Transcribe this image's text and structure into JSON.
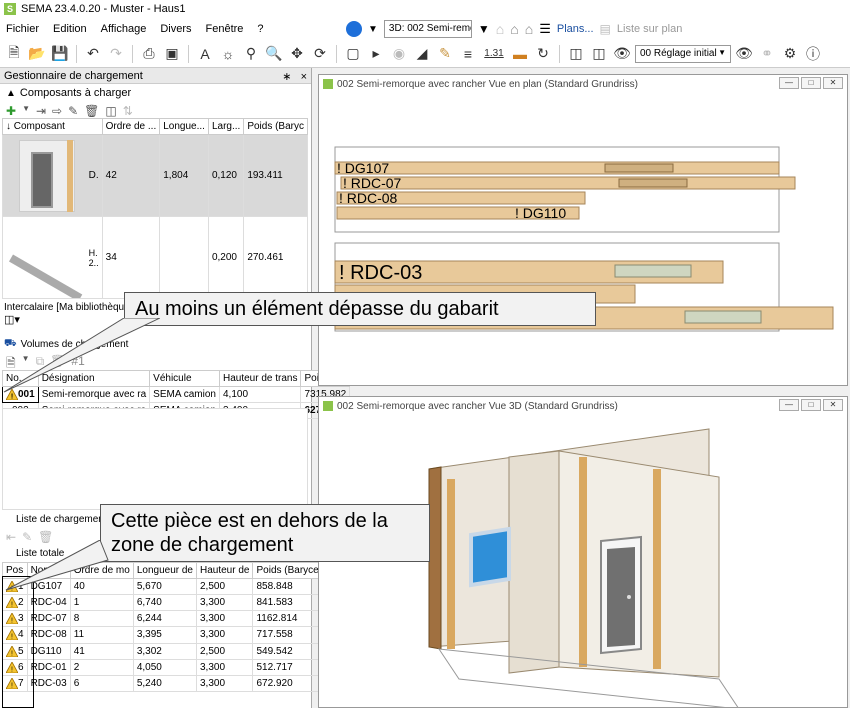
{
  "app": {
    "logo": "S",
    "title": "SEMA  23.4.0.20  -  Muster - Haus1"
  },
  "menu": [
    "Fichier",
    "Edition",
    "Affichage",
    "Divers",
    "Fenêtre",
    "?"
  ],
  "nav": {
    "view_select": "3D: 002 Semi-remorqu",
    "plans": "Plans...",
    "list_plan": "Liste sur plan"
  },
  "toolbar": {
    "number": "1.31",
    "settings": "00 Réglage initial"
  },
  "left": {
    "panel_title": "Gestionnaire de chargement",
    "pin": "∗",
    "close": "×",
    "comp_section": "Composants à charger",
    "comp_columns": [
      "↓ Composant",
      "Ordre de ...",
      "Longue...",
      "Larg...",
      "Poids (Baryc"
    ],
    "comp_rows": [
      {
        "name": "D.",
        "order": "42",
        "length": "1,804",
        "width": "0,120",
        "weight": "193.411"
      },
      {
        "name": "H.\n2..",
        "order": "34",
        "length": "",
        "width": "0,200",
        "weight": "270.461"
      }
    ],
    "intercalaire": "Intercalaire [Ma bibliothèqu",
    "volumes_title": "Volumes de chargement",
    "volumes_columns": [
      "No.",
      "Désignation",
      "Véhicule",
      "Hauteur de trans",
      "Poids"
    ],
    "volumes_rows": [
      {
        "no": "001",
        "designation": "Semi-remorque avec ra",
        "vehicle": "SEMA camion",
        "height": "4,100",
        "weight": "7315.982",
        "warn": true
      },
      {
        "no": "002",
        "designation": "Semi-remorque avec ra",
        "vehicle": "SEMA camion",
        "height": "3,400",
        "weight": "6272.213",
        "warn": false
      }
    ],
    "loading_list_title": "Liste de chargement",
    "total_list_title": "Liste totale",
    "total_columns": [
      "Pos",
      "Nom",
      "Ordre de mo",
      "Longueur de",
      "Hauteur de",
      "Poids (Barycentre/Ch"
    ],
    "total_rows": [
      {
        "pos": "1",
        "name": "DG107",
        "order": "40",
        "length": "5,670",
        "height": "2,500",
        "weight": "858.848"
      },
      {
        "pos": "2",
        "name": "RDC-04",
        "order": "1",
        "length": "6,740",
        "height": "3,300",
        "weight": "841.583"
      },
      {
        "pos": "3",
        "name": "RDC-07",
        "order": "8",
        "length": "6,244",
        "height": "3,300",
        "weight": "1162.814"
      },
      {
        "pos": "4",
        "name": "RDC-08",
        "order": "11",
        "length": "3,395",
        "height": "3,300",
        "weight": "717.558"
      },
      {
        "pos": "5",
        "name": "DG110",
        "order": "41",
        "length": "3,302",
        "height": "2,500",
        "weight": "549.542"
      },
      {
        "pos": "6",
        "name": "RDC-01",
        "order": "2",
        "length": "4,050",
        "height": "3,300",
        "weight": "512.717"
      },
      {
        "pos": "7",
        "name": "RDC-03",
        "order": "6",
        "length": "5,240",
        "height": "3,300",
        "weight": "672.920"
      }
    ]
  },
  "plan_window": {
    "title": "002 Semi-remorque avec rancher Vue en plan (Standard Grundriss)",
    "labels_top": [
      "! DG107",
      "! RDC-07",
      "! RDC-08",
      "! DG110"
    ],
    "labels_bottom": [
      "! RDC-03"
    ]
  },
  "view3d_window": {
    "title": "002 Semi-remorque avec rancher Vue 3D (Standard Grundriss)"
  },
  "callouts": {
    "gauge": "Au moins un élément dépasse du gabarit",
    "outside": "Cette pièce est en dehors de la zone de chargement"
  },
  "colors": {
    "brand": "#8bc34a",
    "wood": "#e8c99a",
    "warning": "#f4c430"
  }
}
